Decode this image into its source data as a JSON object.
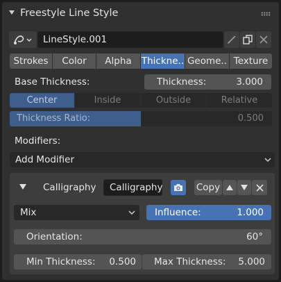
{
  "panel": {
    "title": "Freestyle Line Style"
  },
  "linestyle": {
    "name": "LineStyle.001"
  },
  "tabs": [
    {
      "label": "Strokes",
      "active": false
    },
    {
      "label": "Color",
      "active": false
    },
    {
      "label": "Alpha",
      "active": false
    },
    {
      "label": "Thickne..",
      "active": true
    },
    {
      "label": "Geome..",
      "active": false
    },
    {
      "label": "Texture",
      "active": false
    }
  ],
  "base_thickness": {
    "label": "Base Thickness:",
    "thickness_label": "Thickness:",
    "thickness_value": "3.000"
  },
  "thickness_position": [
    {
      "label": "Center",
      "active": true
    },
    {
      "label": "Inside",
      "active": false
    },
    {
      "label": "Outside",
      "active": false
    },
    {
      "label": "Relative",
      "active": false
    }
  ],
  "thickness_ratio": {
    "label": "Thickness Ratio:",
    "value": "0.500"
  },
  "modifiers": {
    "label": "Modifiers:",
    "add_label": "Add Modifier"
  },
  "modifier": {
    "type_label": "Calligraphy",
    "name": "Calligraphy",
    "copy_label": "Copy",
    "blend": "Mix",
    "influence_label": "Influence:",
    "influence_value": "1.000",
    "orientation_label": "Orientation:",
    "orientation_value": "60°",
    "min_label": "Min Thickness:",
    "min_value": "0.500",
    "max_label": "Max Thickness:",
    "max_value": "5.000"
  },
  "colors": {
    "accent": "#4772b3",
    "panel": "#303030"
  }
}
